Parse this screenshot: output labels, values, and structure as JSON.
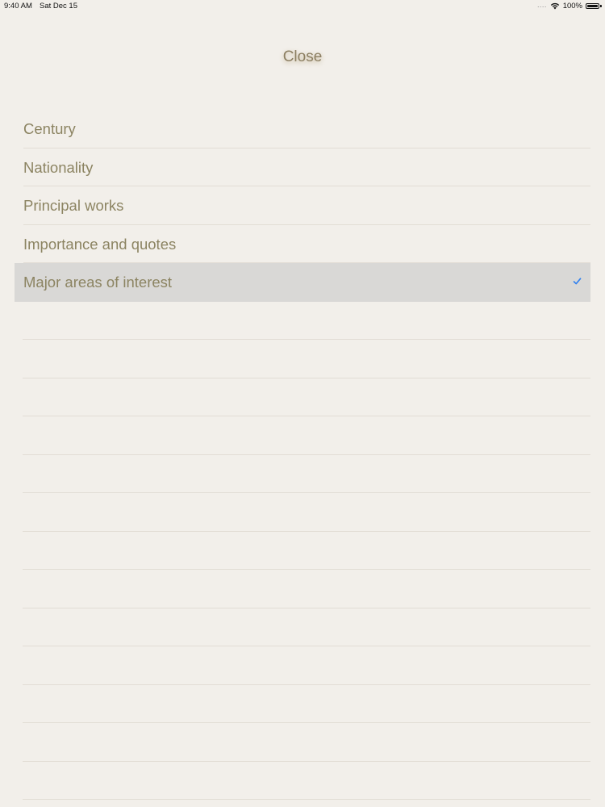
{
  "status": {
    "time": "9:40 AM",
    "date": "Sat Dec 15",
    "battery": "100%",
    "signal_icon": "signal-dots-icon",
    "wifi_icon": "wifi-icon",
    "battery_icon": "battery-icon"
  },
  "header": {
    "close_label": "Close"
  },
  "options": [
    {
      "label": "Century",
      "selected": false
    },
    {
      "label": "Nationality",
      "selected": false
    },
    {
      "label": "Principal works",
      "selected": false
    },
    {
      "label": "Importance and quotes",
      "selected": false
    },
    {
      "label": "Major areas of interest",
      "selected": true
    }
  ],
  "colors": {
    "background": "#f2efea",
    "text": "#8c8462",
    "selected_row": "#d9d8d6",
    "checkmark": "#2d7ff0"
  }
}
